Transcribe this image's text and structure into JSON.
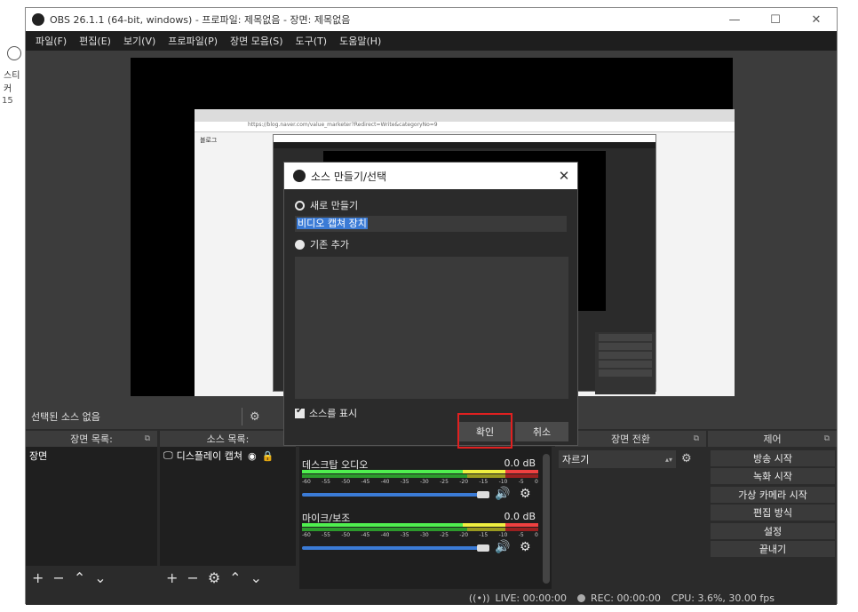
{
  "background": {
    "side_label": "스티커",
    "side_number": "15"
  },
  "window": {
    "title": "OBS 26.1.1 (64-bit, windows) - 프로파일: 제목없음 - 장면: 제목없음",
    "min": "—",
    "max": "☐",
    "close": "✕"
  },
  "menu": [
    "파일(F)",
    "편집(E)",
    "보기(V)",
    "프로파일(P)",
    "장면 모음(S)",
    "도구(T)",
    "도움말(H)"
  ],
  "preview_capture": {
    "blog_label": "블로그",
    "url": "https://blog.naver.com/value_marketer?Redirect=Write&categoryNo=9"
  },
  "dialog": {
    "title": "소스 만들기/선택",
    "close": "✕",
    "create_new_label": "새로 만들기",
    "name_value": "비디오 캡쳐 장치",
    "use_existing_label": "기존 추가",
    "visible_label": "소스를 표시",
    "ok_label": "확인",
    "cancel_label": "취소"
  },
  "selected_source": {
    "label": "선택된 소스 없음",
    "gear": "⚙"
  },
  "docks": {
    "scenes": {
      "title": "장면 목록:",
      "pop": "⧉",
      "items": [
        "장면"
      ]
    },
    "sources": {
      "title": "소스 목록:",
      "pop": "⧉",
      "items": [
        {
          "name": "디스플레이 캡쳐",
          "icon": "monitor-icon"
        }
      ]
    },
    "transitions": {
      "title": "장면 전환",
      "pop": "⧉",
      "selected": "자르기",
      "gear": "⚙"
    },
    "controls": {
      "title": "제어",
      "pop": "⧉",
      "buttons": [
        "방송 시작",
        "녹화 시작",
        "가상 카메라 시작",
        "편집 방식",
        "설정",
        "끝내기"
      ]
    }
  },
  "mixer": {
    "ticks": [
      "-60",
      "-55",
      "-50",
      "-45",
      "-40",
      "-35",
      "-30",
      "-25",
      "-20",
      "-15",
      "-10",
      "-5",
      "0"
    ],
    "channels": [
      {
        "name": "데스크탑 오디오",
        "db": "0.0 dB",
        "volume": 1.0
      },
      {
        "name": "마이크/보조",
        "db": "0.0 dB",
        "volume": 1.0
      }
    ]
  },
  "status": {
    "live": "LIVE: 00:00:00",
    "rec": "REC: 00:00:00",
    "cpu": "CPU: 3.6%, 30.00 fps"
  }
}
